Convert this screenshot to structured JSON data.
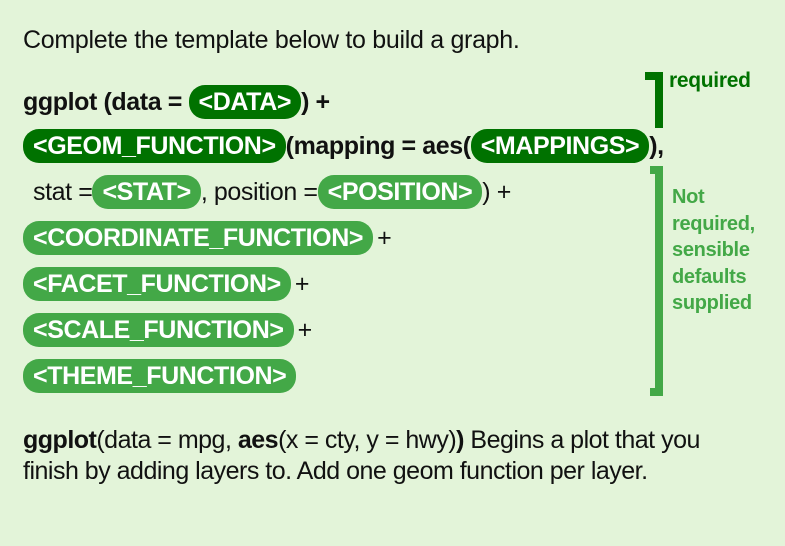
{
  "intro": "Complete the template below to build a graph.",
  "template": {
    "line1": {
      "prefix": "ggplot (data = ",
      "pill": "<DATA>",
      "suffix": ") +"
    },
    "line2": {
      "pill": "<GEOM_FUNCTION>",
      "middle": "(mapping = aes(",
      "pill2": "<MAPPINGS>",
      "suffix": "),"
    },
    "line3": {
      "stat_label": "stat =",
      "stat_pill": "<STAT>",
      "position_label": ", position =",
      "position_pill": "<POSITION>",
      "suffix": ") +"
    },
    "line4": {
      "pill": "<COORDINATE_FUNCTION>",
      "suffix": "+"
    },
    "line5": {
      "pill": "<FACET_FUNCTION>",
      "suffix": "+"
    },
    "line6": {
      "pill": "<SCALE_FUNCTION>",
      "suffix": "+"
    },
    "line7": {
      "pill": "<THEME_FUNCTION>"
    }
  },
  "annotations": {
    "required": "required",
    "optional": "Not required, sensible defaults supplied"
  },
  "colors": {
    "background": "#e3f4d9",
    "required_green": "#007200",
    "optional_green": "#43a847"
  },
  "description": {
    "fn": "ggplot",
    "open": "(data = mpg, ",
    "aes": "aes",
    "args": "(x = cty, y = hwy)",
    "close": ")",
    "text": " Begins a plot that you finish by adding layers to. Add one geom function per layer."
  }
}
